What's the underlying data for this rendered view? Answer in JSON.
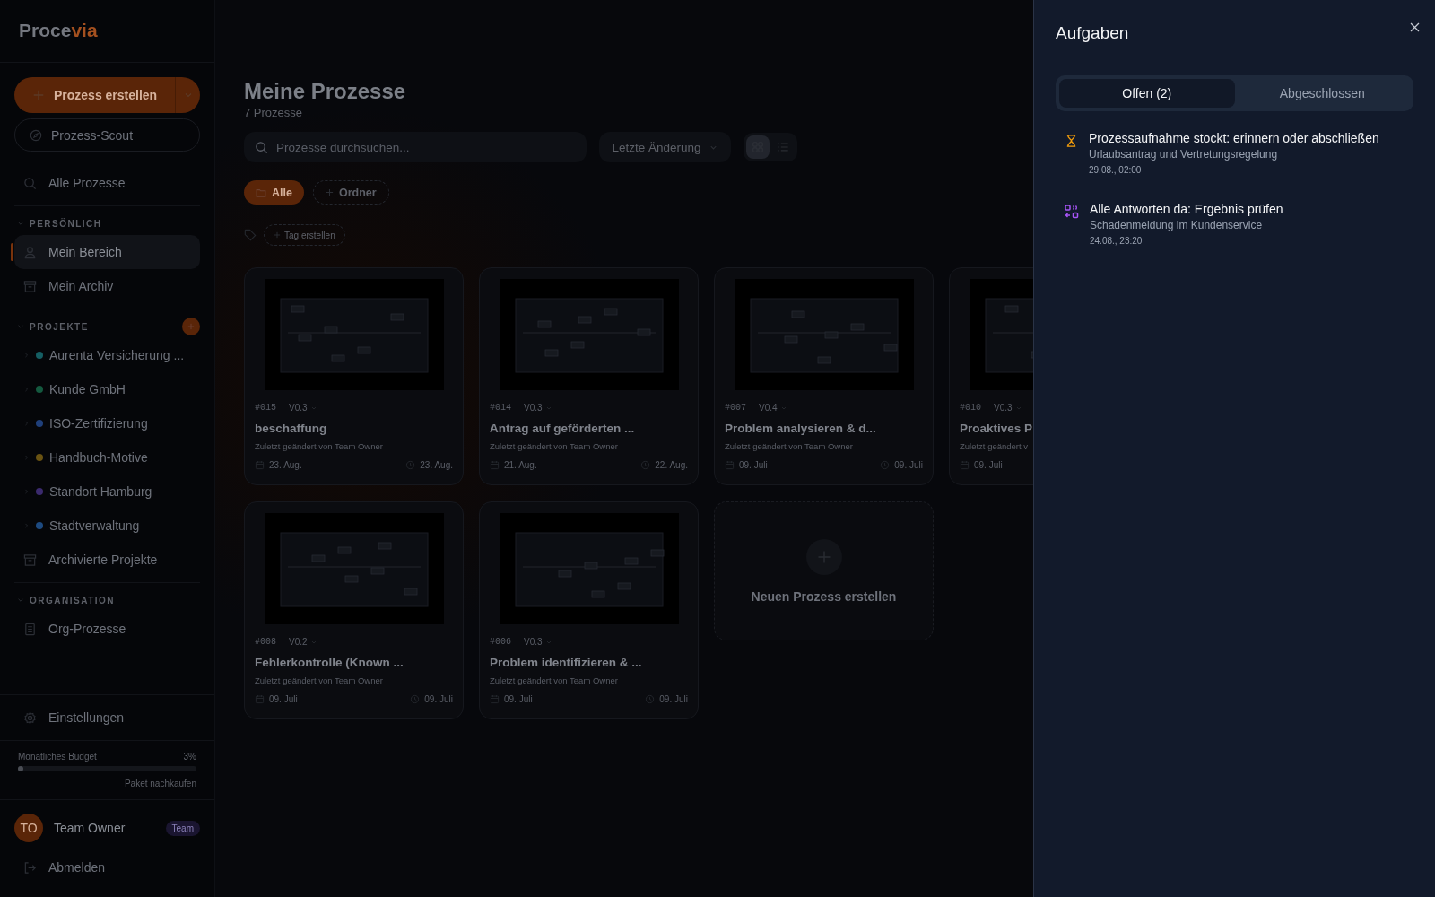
{
  "sidebar": {
    "logo_main": "Proce",
    "logo_accent": "via",
    "create_button": "Prozess erstellen",
    "scout_button": "Prozess-Scout",
    "all_processes": "Alle Prozesse",
    "personal": {
      "label": "PERSÖNLICH",
      "expanded": true,
      "items": [
        {
          "label": "Mein Bereich",
          "kind": "user",
          "selected": true
        },
        {
          "label": "Mein Archiv",
          "kind": "archive",
          "selected": false
        }
      ]
    },
    "projects": {
      "label": "PROJEKTE",
      "expanded": true,
      "items": [
        {
          "label": "Aurenta Versicherung ...",
          "color": "#155e63"
        },
        {
          "label": "Kunde GmbH",
          "color": "#14593f"
        },
        {
          "label": "ISO-Zertifizierung",
          "color": "#1f3f7a"
        },
        {
          "label": "Handbuch-Motive",
          "color": "#6a5312"
        },
        {
          "label": "Standort Hamburg",
          "color": "#3b2a6e"
        },
        {
          "label": "Stadtverwaltung",
          "color": "#1d4a80"
        }
      ]
    },
    "archived_projects": "Archivierte Projekte",
    "organisation": {
      "label": "ORGANISATION",
      "expanded": true,
      "items": [
        {
          "label": "Org-Prozesse",
          "kind": "org"
        }
      ]
    },
    "settings": "Einstellungen",
    "budget": {
      "label": "Monatliches Budget",
      "reading": "3%",
      "level": 0.03,
      "link": "Paket nachkaufen"
    },
    "user": {
      "initials": "TO",
      "name": "Team Owner",
      "badge": "Team"
    },
    "logout": "Abmelden"
  },
  "main": {
    "title": "Meine Prozesse",
    "count": "7 Prozesse",
    "search": {
      "placeholder": "Prozesse durchsuchen..."
    },
    "sort": "Letzte Änderung",
    "views": [
      {
        "kind": "grid",
        "selected": true
      },
      {
        "kind": "list",
        "selected": false
      }
    ],
    "folders": [
      {
        "label": "Alle",
        "selected": true
      }
    ],
    "add_folder": "Ordner",
    "add_tag": "Tag erstellen",
    "cards": [
      {
        "id": "#015",
        "version": "V0.3",
        "title": "beschaffung",
        "subtitle": "Zuletzt geändert von Team Owner",
        "created": "23. Aug.",
        "updated": "23. Aug."
      },
      {
        "id": "#014",
        "version": "V0.3",
        "title": "Antrag auf geförderten ...",
        "subtitle": "Zuletzt geändert von Team Owner",
        "created": "21. Aug.",
        "updated": "22. Aug."
      },
      {
        "id": "#007",
        "version": "V0.4",
        "title": "Problem analysieren & d...",
        "subtitle": "Zuletzt geändert von Team Owner",
        "created": "09. Juli",
        "updated": "09. Juli"
      },
      {
        "id": "#010",
        "version": "V0.3",
        "title": "Proaktives P",
        "subtitle": "Zuletzt geändert v",
        "created": "09. Juli"
      },
      {
        "id": "#008",
        "version": "V0.2",
        "title": "Fehlerkontrolle (Known ...",
        "subtitle": "Zuletzt geändert von Team Owner",
        "created": "09. Juli",
        "updated": "09. Juli"
      },
      {
        "id": "#006",
        "version": "V0.3",
        "title": "Problem identifizieren & ...",
        "subtitle": "Zuletzt geändert von Team Owner",
        "created": "09. Juli",
        "updated": "09. Juli"
      }
    ],
    "new_card": "Neuen Prozess erstellen"
  },
  "panel": {
    "title": "Aufgaben",
    "tabs": [
      {
        "label": "Offen (2)",
        "selected": true
      },
      {
        "label": "Abgeschlossen",
        "selected": false
      }
    ],
    "tasks": [
      {
        "kind": "stalled",
        "title": "Prozessaufnahme stockt: erinnern oder abschließen",
        "subtitle": "Urlaubsantrag und Vertretungsregelung",
        "time": "29.08., 02:00"
      },
      {
        "kind": "review",
        "title": "Alle Antworten da: Ergebnis prüfen",
        "subtitle": "Schadenmeldung im Kundenservice",
        "time": "24.08., 23:20"
      }
    ]
  }
}
